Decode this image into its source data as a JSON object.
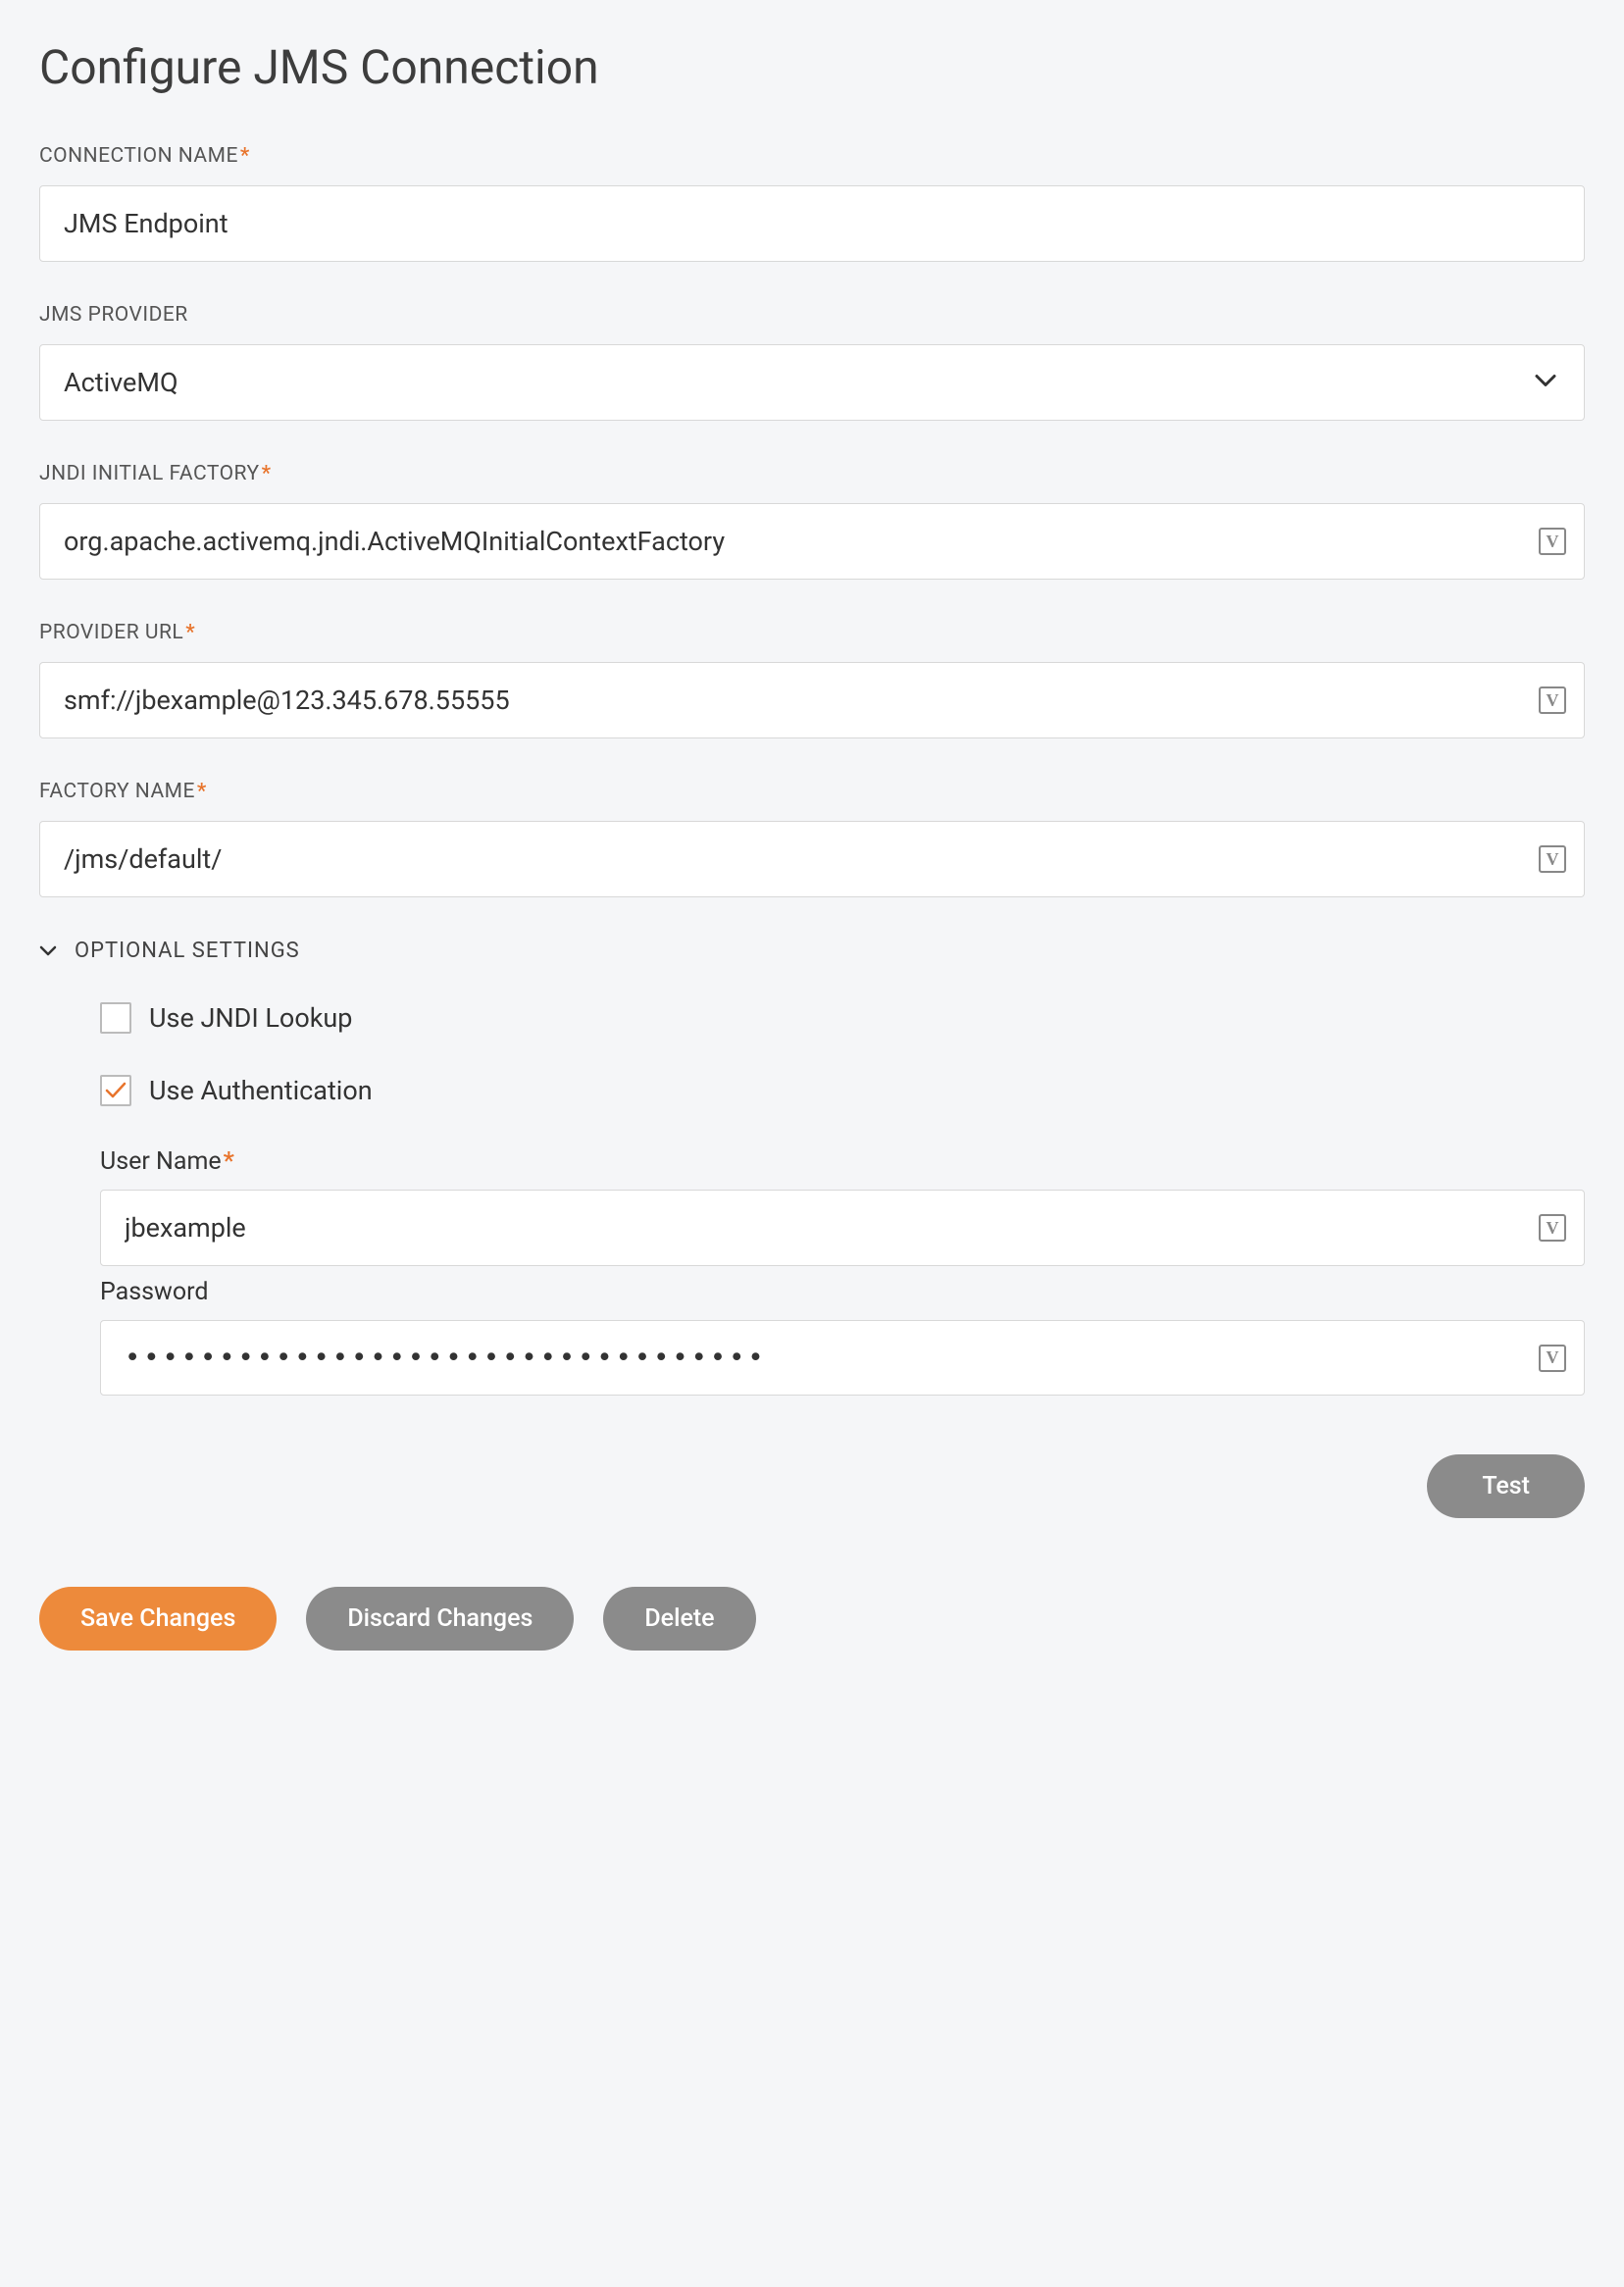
{
  "title": "Configure JMS Connection",
  "fields": {
    "connection_name": {
      "label": "CONNECTION NAME",
      "required": true,
      "value": "JMS Endpoint"
    },
    "jms_provider": {
      "label": "JMS PROVIDER",
      "required": false,
      "value": "ActiveMQ"
    },
    "jndi_initial_factory": {
      "label": "JNDI INITIAL FACTORY",
      "required": true,
      "value": "org.apache.activemq.jndi.ActiveMQInitialContextFactory"
    },
    "provider_url": {
      "label": "PROVIDER URL",
      "required": true,
      "value": "smf://jbexample@123.345.678.55555"
    },
    "factory_name": {
      "label": "FACTORY NAME",
      "required": true,
      "value": "/jms/default/"
    }
  },
  "optional": {
    "header": "OPTIONAL SETTINGS",
    "use_jndi_lookup": {
      "label": "Use JNDI Lookup",
      "checked": false
    },
    "use_authentication": {
      "label": "Use Authentication",
      "checked": true
    },
    "username": {
      "label": "User Name",
      "required": true,
      "value": "jbexample"
    },
    "password": {
      "label": "Password",
      "required": false,
      "value": "••••••••••••••••••••••••••••••••••"
    }
  },
  "buttons": {
    "test": "Test",
    "save": "Save Changes",
    "discard": "Discard Changes",
    "delete": "Delete"
  },
  "required_marker": "*"
}
